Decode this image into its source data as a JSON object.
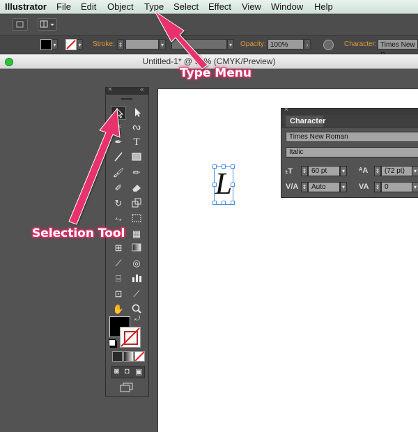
{
  "menubar": {
    "app_name": "Illustrator",
    "items": [
      "File",
      "Edit",
      "Object",
      "Type",
      "Select",
      "Effect",
      "View",
      "Window",
      "Help"
    ]
  },
  "controlbar": {
    "stroke_label": "Stroke:",
    "opacity_label": "Opacity:",
    "opacity_value": "100%",
    "character_label": "Character:",
    "font_value": "Times New R"
  },
  "document": {
    "title": "Untitled-1* @ 91% (CMYK/Preview)",
    "glyph": "L"
  },
  "character_panel": {
    "tab_label": "Character",
    "font_family": "Times New Roman",
    "font_style": "Italic",
    "font_size": "60 pt",
    "leading": "(72 pt)",
    "kerning": "Auto",
    "tracking": "0"
  },
  "annotations": {
    "type_menu": "Type Menu",
    "selection_tool": "Selection Tool"
  },
  "colors": {
    "annotation_pink": "#e0336a",
    "accent_orange": "#e39a3a",
    "selection_blue": "#4c8ee6"
  }
}
